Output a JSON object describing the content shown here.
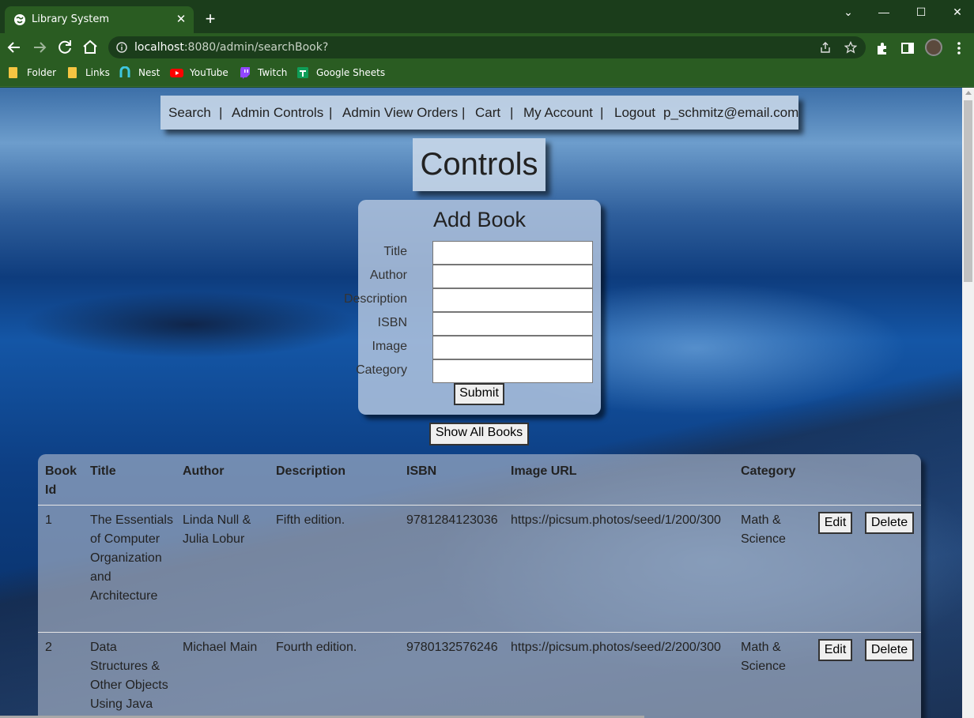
{
  "browser": {
    "tab_title": "Library System",
    "url_host": "localhost",
    "url_rest": ":8080/admin/searchBook?",
    "bookmarks": [
      "Folder",
      "Links",
      "Nest",
      "YouTube",
      "Twitch",
      "Google Sheets"
    ]
  },
  "nav": {
    "search": "Search",
    "admin_controls": "Admin Controls",
    "admin_view_orders": "Admin View Orders",
    "cart": "Cart",
    "my_account": "My Account",
    "logout": "Logout",
    "user_email": "p_schmitz@email.com",
    "separator": "|"
  },
  "page_title": "Controls",
  "add_book": {
    "title": "Add Book",
    "fields": [
      "Title",
      "Author",
      "Description",
      "ISBN",
      "Image",
      "Category"
    ],
    "submit": "Submit"
  },
  "show_all_button": "Show All Books",
  "table": {
    "headers": [
      "Book Id",
      "Title",
      "Author",
      "Description",
      "ISBN",
      "Image URL",
      "Category"
    ],
    "edit_label": "Edit",
    "delete_label": "Delete",
    "rows": [
      {
        "id": "1",
        "title": "The Essentials of Computer Organization and Architecture",
        "author": "Linda Null & Julia Lobur",
        "description": "Fifth edition.",
        "isbn": "9781284123036",
        "image_url": "https://picsum.photos/seed/1/200/300",
        "category": "Math & Science"
      },
      {
        "id": "2",
        "title": "Data Structures & Other Objects Using Java",
        "author": "Michael Main",
        "description": "Fourth edition.",
        "isbn": "9780132576246",
        "image_url": "https://picsum.photos/seed/2/200/300",
        "category": "Math & Science"
      }
    ]
  }
}
